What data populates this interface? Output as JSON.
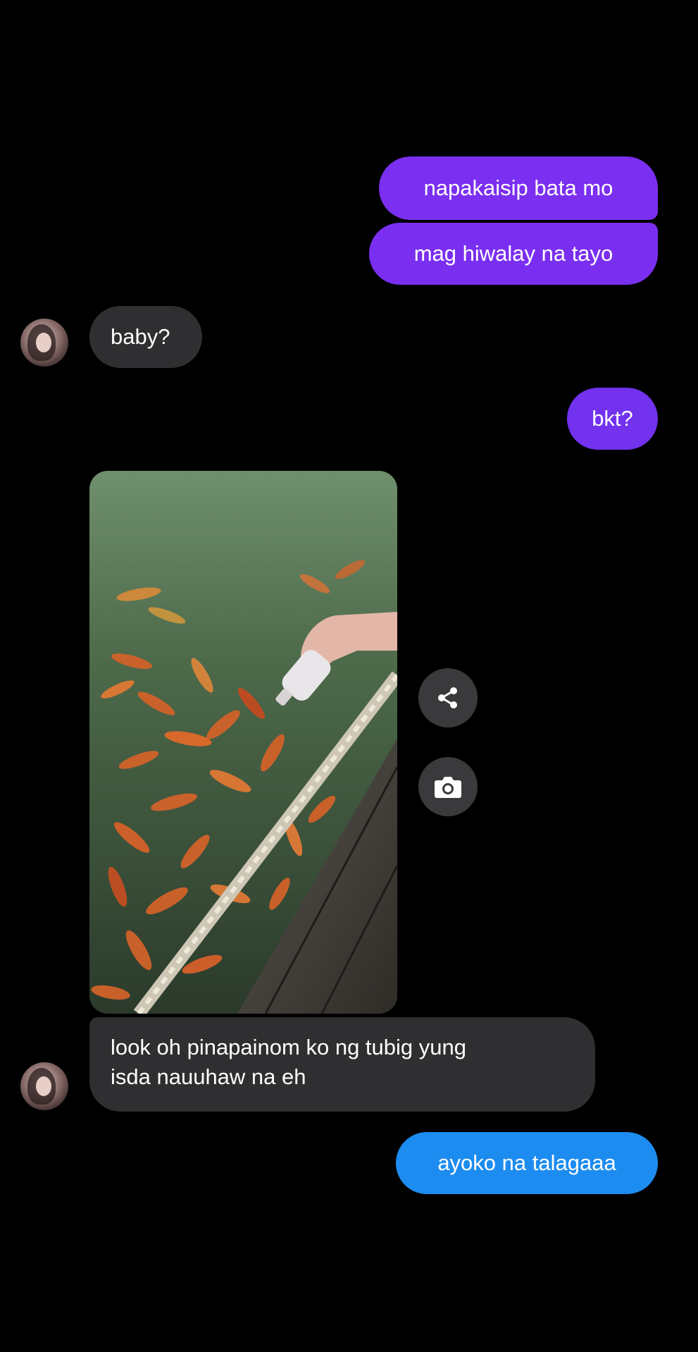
{
  "messages": {
    "sent_1": "napakaisip bata mo",
    "sent_2": "mag hiwalay na tayo",
    "recv_1": "baby?",
    "sent_3": "bkt?",
    "recv_2_line1": "look oh pinapainom ko ng tubig yung",
    "recv_2_line2": "isda nauuhaw na eh",
    "sent_4": "ayoko na talagaaa"
  },
  "colors": {
    "background": "#000000",
    "sent_bubble_purple": "#7b2ff0",
    "sent_bubble_blue": "#1d8cf0",
    "received_bubble": "#2f2f31"
  },
  "icons": {
    "share": "share-icon",
    "camera": "camera-icon"
  }
}
